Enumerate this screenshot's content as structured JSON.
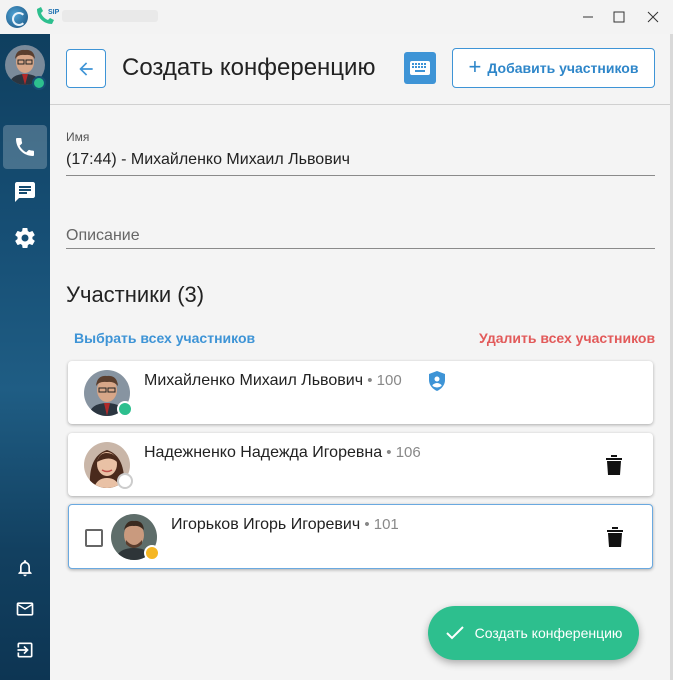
{
  "titlebar": {
    "app_badge": "SIP",
    "controls": [
      "minimize-icon",
      "maximize-icon",
      "close-icon"
    ]
  },
  "sidebar": {
    "top_items": [
      {
        "icon": "phone-icon",
        "active": true
      },
      {
        "icon": "chat-icon",
        "active": false
      },
      {
        "icon": "gear-icon",
        "active": false
      }
    ],
    "bottom_items": [
      {
        "icon": "bell-icon"
      },
      {
        "icon": "mail-icon"
      },
      {
        "icon": "logout-icon"
      }
    ]
  },
  "header": {
    "title": "Создать конференцию",
    "add_participants_label": "Добавить участников"
  },
  "form": {
    "name_label": "Имя",
    "name_value": "(17:44) - Михайленко Михаил Львович",
    "description_placeholder": "Описание"
  },
  "participants": {
    "title": "Участники (3)",
    "select_all_label": "Выбрать всех участников",
    "delete_all_label": "Удалить всех участников",
    "items": [
      {
        "name": "Михайленко Михаил Львович",
        "ext": " • 100",
        "status": "online",
        "admin": true
      },
      {
        "name": "Надежненко Надежда Игоревна",
        "ext": " • 106",
        "status": "offline",
        "admin": false
      },
      {
        "name": "Игорьков Игорь Игоревич",
        "ext": " • 101",
        "status": "away",
        "admin": false
      }
    ]
  },
  "fab": {
    "label": "Создать конференцию"
  },
  "colors": {
    "accent": "#3e94d6",
    "success": "#2dbf8e",
    "danger": "#e25a5a",
    "away": "#f5b623"
  }
}
